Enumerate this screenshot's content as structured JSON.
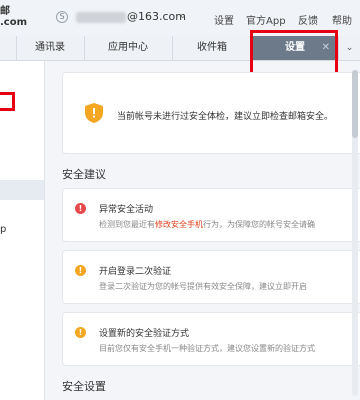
{
  "top": {
    "logo_line1": "邮",
    "logo_line2": ".com",
    "account_icon": "S",
    "account_domain": "@163.com",
    "account_caret": "⌄",
    "links": [
      "设置",
      "官方App",
      "反馈",
      "帮助"
    ]
  },
  "tabs": [
    "通讯录",
    "应用中心",
    "收件箱",
    "设置"
  ],
  "active_tab_close": "✕",
  "tab_more": "⌄",
  "sidebar": {
    "partial_text": "p"
  },
  "notice": {
    "text": "当前帐号未进行过安全体检，建议立即检查邮箱安全。"
  },
  "security_suggestions": {
    "title": "安全建议",
    "items": [
      {
        "icon": "!",
        "title": "异常安全活动",
        "desc_prefix": "检测到您最近有",
        "desc_link": "修改安全手机",
        "desc_suffix": "行为，为保障您的帐号安全请确"
      },
      {
        "icon": "!",
        "title": "开启登录二次验证",
        "desc": "登录二次验证为您的帐号提供有效安全保障，建议立即开启"
      },
      {
        "icon": "!",
        "title": "设置新的安全验证方式",
        "desc": "目前您仅有安全手机一种验证方式，建议您设置新的验证方式"
      }
    ]
  },
  "security_settings": {
    "title": "安全设置"
  },
  "colors": {
    "highlight": "#e60012",
    "danger": "#e5484d",
    "warn": "#f5a623",
    "active_tab": "#6c7a89"
  }
}
